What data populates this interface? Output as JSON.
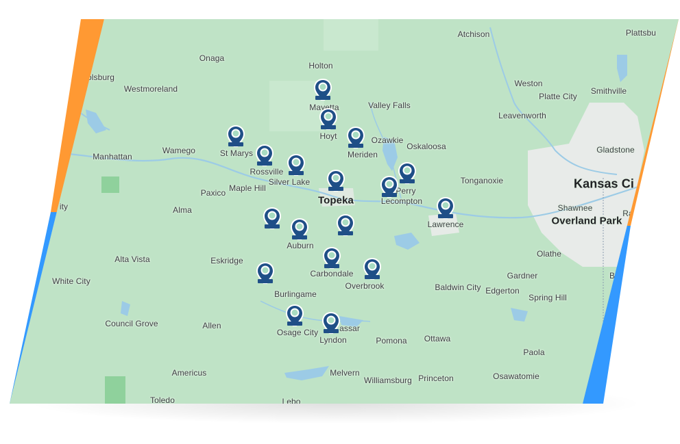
{
  "map": {
    "place_labels": [
      {
        "id": "atchison",
        "text": "Atchison"
      },
      {
        "id": "plattsburg",
        "text": "Plattsbu"
      },
      {
        "id": "onaga",
        "text": "Onaga"
      },
      {
        "id": "holton",
        "text": "Holton"
      },
      {
        "id": "olsburg",
        "text": "olsburg"
      },
      {
        "id": "westmoreland",
        "text": "Westmoreland"
      },
      {
        "id": "mayetta",
        "text": "Mayetta"
      },
      {
        "id": "valley-falls",
        "text": "Valley Falls"
      },
      {
        "id": "weston",
        "text": "Weston"
      },
      {
        "id": "platte-city",
        "text": "Platte City"
      },
      {
        "id": "smithville",
        "text": "Smithville"
      },
      {
        "id": "leavenworth",
        "text": "Leavenworth"
      },
      {
        "id": "hoyt",
        "text": "Hoyt"
      },
      {
        "id": "ozawkie",
        "text": "Ozawkie"
      },
      {
        "id": "oskaloosa",
        "text": "Oskaloosa"
      },
      {
        "id": "meriden",
        "text": "Meriden"
      },
      {
        "id": "gladstone",
        "text": "Gladstone"
      },
      {
        "id": "wamego",
        "text": "Wamego"
      },
      {
        "id": "st-marys",
        "text": "St Marys"
      },
      {
        "id": "manhattan",
        "text": "Manhattan"
      },
      {
        "id": "rossville",
        "text": "Rossville"
      },
      {
        "id": "silver-lake",
        "text": "Silver Lake"
      },
      {
        "id": "perry",
        "text": "Perry"
      },
      {
        "id": "tonganoxie",
        "text": "Tonganoxie"
      },
      {
        "id": "kansas-city",
        "text": "Kansas Ci"
      },
      {
        "id": "paxico",
        "text": "Paxico"
      },
      {
        "id": "maple-hill",
        "text": "Maple Hill"
      },
      {
        "id": "topeka",
        "text": "Topeka"
      },
      {
        "id": "lecompton",
        "text": "Lecompton"
      },
      {
        "id": "city-left",
        "text": "ity"
      },
      {
        "id": "alma",
        "text": "Alma"
      },
      {
        "id": "shawnee",
        "text": "Shawnee"
      },
      {
        "id": "overland-park",
        "text": "Overland Park"
      },
      {
        "id": "lawrence",
        "text": "Lawrence"
      },
      {
        "id": "ra",
        "text": "Ra"
      },
      {
        "id": "auburn",
        "text": "Auburn"
      },
      {
        "id": "olathe",
        "text": "Olathe"
      },
      {
        "id": "alta-vista",
        "text": "Alta Vista"
      },
      {
        "id": "eskridge",
        "text": "Eskridge"
      },
      {
        "id": "carbondale",
        "text": "Carbondale"
      },
      {
        "id": "gardner",
        "text": "Gardner"
      },
      {
        "id": "b",
        "text": "B"
      },
      {
        "id": "white-city",
        "text": "White City"
      },
      {
        "id": "overbrook",
        "text": "Overbrook"
      },
      {
        "id": "baldwin-city",
        "text": "Baldwin City"
      },
      {
        "id": "edgerton",
        "text": "Edgerton"
      },
      {
        "id": "burlingame",
        "text": "Burlingame"
      },
      {
        "id": "spring-hill",
        "text": "Spring Hill"
      },
      {
        "id": "council-grove",
        "text": "Council Grove"
      },
      {
        "id": "allen",
        "text": "Allen"
      },
      {
        "id": "vassar",
        "text": "assar"
      },
      {
        "id": "osage-city",
        "text": "Osage City"
      },
      {
        "id": "lyndon",
        "text": "Lyndon"
      },
      {
        "id": "pomona",
        "text": "Pomona"
      },
      {
        "id": "ottawa",
        "text": "Ottawa"
      },
      {
        "id": "paola",
        "text": "Paola"
      },
      {
        "id": "americus",
        "text": "Americus"
      },
      {
        "id": "melvern",
        "text": "Melvern"
      },
      {
        "id": "williamsburg",
        "text": "Williamsburg"
      },
      {
        "id": "princeton",
        "text": "Princeton"
      },
      {
        "id": "osawatomie",
        "text": "Osawatomie"
      },
      {
        "id": "toledo",
        "text": "Toledo"
      },
      {
        "id": "lebo",
        "text": "Lebo"
      }
    ],
    "marker_count": 17,
    "colors": {
      "land": "#bfe3c6",
      "urban": "#e8ebe9",
      "water": "#9ccbe6",
      "marker": "#1f4f87",
      "accent_orange": "#ff9933",
      "accent_blue": "#3399ff"
    }
  }
}
